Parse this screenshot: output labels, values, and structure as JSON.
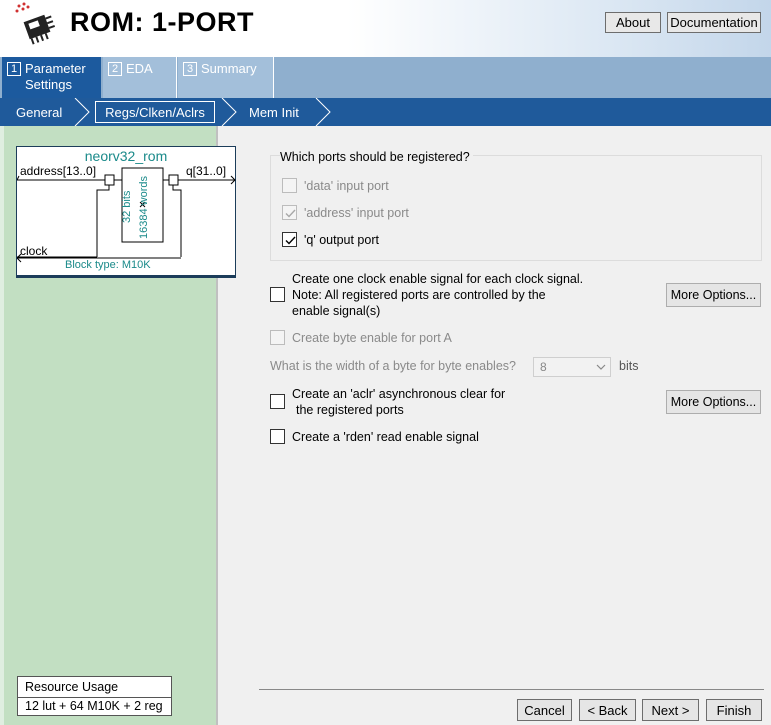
{
  "header": {
    "title": "ROM: 1-PORT",
    "about_label": "About",
    "documentation_label": "Documentation"
  },
  "tabs": [
    {
      "num": "1",
      "label": "Parameter Settings"
    },
    {
      "num": "2",
      "label": "EDA"
    },
    {
      "num": "3",
      "label": "Summary"
    }
  ],
  "subtabs": {
    "general": "General",
    "regs": "Regs/Clken/Aclrs",
    "meminit": "Mem Init"
  },
  "diagram": {
    "name": "neorv32_rom",
    "address": "address[13..0]",
    "q": "q[31..0]",
    "clock": "clock",
    "bits": "32 bits",
    "words": "16384 words",
    "block_type": "Block type: M10K"
  },
  "resource": {
    "heading": "Resource Usage",
    "value": "12 lut + 64 M10K + 2 reg"
  },
  "ports_group": {
    "title": "Which ports should be registered?",
    "data_label": "'data' input port",
    "address_label": "'address' input port",
    "q_label": "'q' output port"
  },
  "options": {
    "clock_enable_line1": "Create one clock enable signal for each clock signal.",
    "clock_enable_line2": "Note: All registered ports are controlled by the",
    "clock_enable_line3": "enable signal(s)",
    "more_options_label": "More Options...",
    "byte_enable_label": "Create byte enable for port A",
    "byte_width_label": "What is the width of a byte for byte enables?",
    "byte_width_value": "8",
    "byte_width_unit": "bits",
    "aclr_line1": "Create an 'aclr' asynchronous clear for",
    "aclr_line2": "the registered ports",
    "rden_label": "Create a 'rden' read enable signal"
  },
  "footer": {
    "cancel": "Cancel",
    "back": "< Back",
    "next": "Next >",
    "finish": "Finish"
  },
  "colors": {
    "tab_active": "#1c5a9e",
    "tab_bar": "#8fafce",
    "subtab_bar": "#1f5a9b",
    "left_panel": "#c2dfc2",
    "diagram_teal": "#1a8a8a"
  }
}
